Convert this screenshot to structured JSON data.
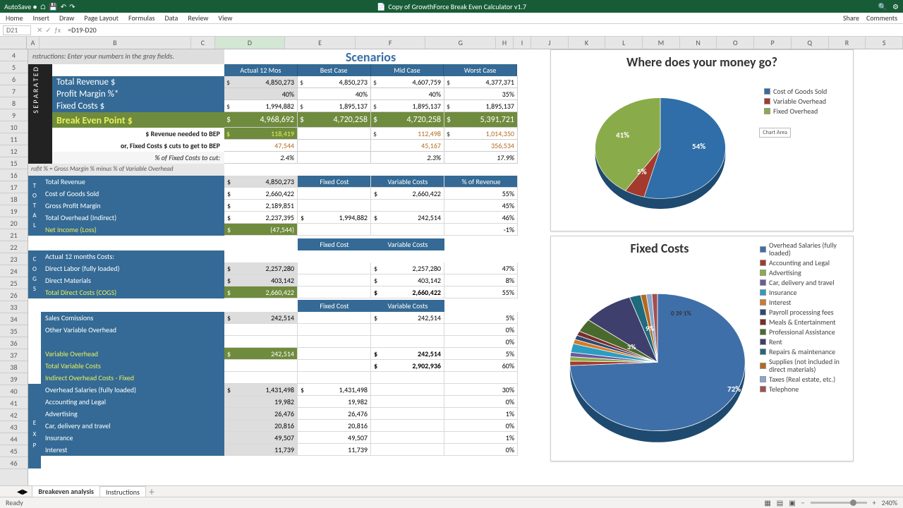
{
  "app": {
    "autosave": "AutoSave ●",
    "title": "Copy of GrowthForce Break Even Calculator v1.7",
    "share": "Share",
    "comments": "Comments"
  },
  "ribbon": {
    "tabs": [
      "Home",
      "Insert",
      "Draw",
      "Page Layout",
      "Formulas",
      "Data",
      "Review",
      "View"
    ]
  },
  "formula": {
    "cellref": "D21",
    "formula": "=D19-D20"
  },
  "columns": [
    "A",
    "B",
    "C",
    "D",
    "E",
    "F",
    "G",
    "H",
    "I",
    "J",
    "K",
    "L",
    "M",
    "N",
    "O",
    "P",
    "Q",
    "R",
    "S"
  ],
  "rows_visible": [
    4,
    5,
    6,
    7,
    8,
    9,
    10,
    11,
    12,
    15,
    16,
    17,
    18,
    19,
    20,
    21,
    22,
    23,
    24,
    25,
    26,
    33,
    34,
    35,
    36,
    37,
    38,
    39,
    40,
    41,
    42,
    43,
    44,
    45,
    46
  ],
  "instructions": "nstructions: Enter your numbers in the gray fields.",
  "scenarios": {
    "title": "Scenarios",
    "headers": [
      "Actual  12 Mos",
      "Best Case",
      "Mid Case",
      "Worst Case"
    ]
  },
  "kpi_labels": {
    "rev": "Total Revenue $",
    "margin": "Profit Margin %*",
    "fixed": "Fixed Costs $",
    "bep": "Break Even Point $",
    "need": "$ Revenue needed to BEP",
    "cuts": "or, Fixed Costs $ cuts to get to BEP",
    "pctcut": "% of Fixed Costs to cut:",
    "note": "rofit % = Gross Margin % minus % of Variable Overhead"
  },
  "kpi": {
    "rev": [
      "4,850,273",
      "4,850,273",
      "4,607,759",
      "4,377,371"
    ],
    "margin": [
      "40%",
      "40%",
      "40%",
      "35%"
    ],
    "fixed": [
      "1,994,882",
      "1,895,137",
      "1,895,137",
      "1,895,137"
    ],
    "bep": [
      "4,968,692",
      "4,720,258",
      "4,720,258",
      "5,391,721"
    ],
    "need": [
      "118,419",
      "",
      "112,498",
      "1,014,350"
    ],
    "cuts": [
      "47,544",
      "",
      "45,167",
      "356,534"
    ],
    "pctcut": [
      "2.4%",
      "",
      "2.3%",
      "17.9%"
    ]
  },
  "totals": {
    "headers": [
      "Fixed Cost",
      "Variable Costs",
      "% of Revenue"
    ],
    "rows": [
      {
        "label": "Total Revenue",
        "d": "4,850,273",
        "f": "",
        "g": "",
        "h": ""
      },
      {
        "label": "Cost of Goods Sold",
        "d": "2,660,422",
        "f": "",
        "g": "2,660,422",
        "h": "55%"
      },
      {
        "label": "Gross Profit Margin",
        "d": "2,189,851",
        "f": "",
        "g": "",
        "h": "45%"
      },
      {
        "label": "Total Overhead (Indirect)",
        "d": "2,237,395",
        "f": "1,994,882",
        "g": "242,514",
        "h": "46%"
      },
      {
        "label": "Net Income (Loss)",
        "d": "(47,544)",
        "f": "",
        "g": "",
        "h": "-1%"
      }
    ]
  },
  "cogs": {
    "header": "Actual 12 months Costs:",
    "rows": [
      {
        "label": "Direct Labor (fully loaded)",
        "d": "2,257,280",
        "g": "2,257,280",
        "h": "47%"
      },
      {
        "label": "Direct Materials",
        "d": "403,142",
        "g": "403,142",
        "h": "8%"
      },
      {
        "label": "Total Direct Costs (COGS)",
        "d": "2,660,422",
        "g": "2,660,422",
        "h": "55%",
        "yellow": true
      }
    ]
  },
  "varover": {
    "rows": [
      {
        "label": "Sales Comissions",
        "d": "242,514",
        "g": "242,514",
        "h": "5%"
      },
      {
        "label": "Other Variable Overhead",
        "d": "",
        "g": "",
        "h": "0%"
      },
      {
        "label": "",
        "d": "",
        "g": "",
        "h": "0%"
      },
      {
        "label": "Variable Overhead",
        "d": "242,514",
        "g": "242,514",
        "h": "5%",
        "yellow": true
      },
      {
        "label": "Total Variable Costs",
        "d": "",
        "g": "2,902,936",
        "h": "60%",
        "yellow": true
      },
      {
        "label": "Indirect Overhead Costs - Fixed",
        "d": "",
        "g": "",
        "h": "",
        "yellow": true
      }
    ]
  },
  "fixedexp": {
    "rows": [
      {
        "label": "Overhead Salaries (fully loaded)",
        "d": "1,431,498",
        "f": "1,431,498",
        "h": "30%"
      },
      {
        "label": "Accounting and Legal",
        "d": "19,982",
        "f": "19,982",
        "h": "0%"
      },
      {
        "label": "Advertising",
        "d": "26,476",
        "f": "26,476",
        "h": "1%"
      },
      {
        "label": "Car, delivery and travel",
        "d": "20,816",
        "f": "20,816",
        "h": "0%"
      },
      {
        "label": "Insurance",
        "d": "49,507",
        "f": "49,507",
        "h": "1%"
      },
      {
        "label": "Interest",
        "d": "11,739",
        "f": "11,739",
        "h": "0%"
      }
    ]
  },
  "chart_data": [
    {
      "type": "pie",
      "title": "Where does your money go?",
      "series": [
        {
          "name": "Cost of Goods Sold",
          "value": 54,
          "color": "#2f6ea8"
        },
        {
          "name": "Variable Overhead",
          "value": 5,
          "color": "#a33a2d"
        },
        {
          "name": "Fixed Overhead",
          "value": 41,
          "color": "#8aab4a"
        }
      ],
      "labels": [
        "54%",
        "5%",
        "41%"
      ]
    },
    {
      "type": "pie",
      "title": "Fixed Costs",
      "series": [
        {
          "name": "Overhead Salaries (fully loaded)",
          "value": 72,
          "color": "#3f6fa8"
        },
        {
          "name": "Accounting and Legal",
          "value": 1,
          "color": "#a33a2d"
        },
        {
          "name": "Advertising",
          "value": 1,
          "color": "#8aab4a"
        },
        {
          "name": "Car, delivery and travel",
          "value": 1,
          "color": "#6a5a9d"
        },
        {
          "name": "Insurance",
          "value": 2,
          "color": "#2b9dc1"
        },
        {
          "name": "Interest",
          "value": 1,
          "color": "#d27a2a"
        },
        {
          "name": "Payroll processing fees",
          "value": 1,
          "color": "#2d4a70"
        },
        {
          "name": "Meals & Entertainment",
          "value": 1,
          "color": "#7a2d2d"
        },
        {
          "name": "Professional Assistance",
          "value": 3,
          "color": "#4a6a2d"
        },
        {
          "name": "Rent",
          "value": 9,
          "color": "#3f3f6d"
        },
        {
          "name": "Repairs & maintenance",
          "value": 2,
          "color": "#1f6a7d"
        },
        {
          "name": "Supplies (not included in direct materials)",
          "value": 1,
          "color": "#b36a1f"
        },
        {
          "name": "Taxes (Real estate, etc.)",
          "value": 1,
          "color": "#8aa5d0"
        },
        {
          "name": "Telephone",
          "value": 1,
          "color": "#a05050"
        }
      ],
      "labels": [
        "72%",
        "3%",
        "9%",
        "0 39 1%"
      ]
    }
  ],
  "chart_area_btn": "Chart Area",
  "tabs": {
    "sheets": [
      "Breakeven analysis",
      "Instructions"
    ],
    "active": 0
  },
  "status": {
    "ready": "Ready",
    "zoom": "240%"
  }
}
